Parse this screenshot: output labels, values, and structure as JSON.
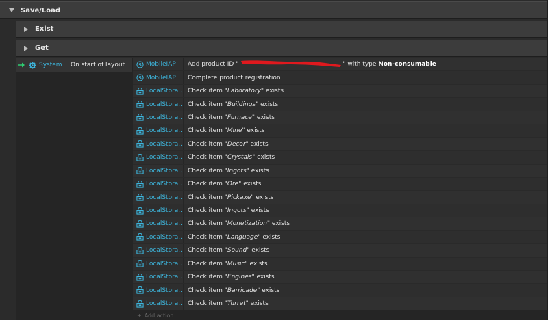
{
  "groups": {
    "main": {
      "title": "Save/Load"
    },
    "exist": {
      "title": "Exist"
    },
    "get": {
      "title": "Get"
    }
  },
  "event": {
    "condition_object": "System",
    "trigger": "On start of layout"
  },
  "actions": [
    {
      "object": "MobileIAP",
      "icon": "mobileiap-icon",
      "prefix": "Add product ID \"",
      "redacted": true,
      "suffix": "\" with type ",
      "bold": "Non-consumable"
    },
    {
      "object": "MobileIAP",
      "icon": "mobileiap-icon",
      "text": "Complete product registration"
    },
    {
      "object": "LocalStora...",
      "icon": "localstorage-icon",
      "item": "Laboratory"
    },
    {
      "object": "LocalStora...",
      "icon": "localstorage-icon",
      "item": "Buildings"
    },
    {
      "object": "LocalStora...",
      "icon": "localstorage-icon",
      "item": "Furnace"
    },
    {
      "object": "LocalStora...",
      "icon": "localstorage-icon",
      "item": "Mine"
    },
    {
      "object": "LocalStora...",
      "icon": "localstorage-icon",
      "item": "Decor"
    },
    {
      "object": "LocalStora...",
      "icon": "localstorage-icon",
      "item": "Crystals"
    },
    {
      "object": "LocalStora...",
      "icon": "localstorage-icon",
      "item": "Ingots"
    },
    {
      "object": "LocalStora...",
      "icon": "localstorage-icon",
      "item": "Ore"
    },
    {
      "object": "LocalStora...",
      "icon": "localstorage-icon",
      "item": "Pickaxe"
    },
    {
      "object": "LocalStora...",
      "icon": "localstorage-icon",
      "item": "Ingots"
    },
    {
      "object": "LocalStora...",
      "icon": "localstorage-icon",
      "item": "Monetization"
    },
    {
      "object": "LocalStora...",
      "icon": "localstorage-icon",
      "item": "Language"
    },
    {
      "object": "LocalStora...",
      "icon": "localstorage-icon",
      "item": "Sound"
    },
    {
      "object": "LocalStora...",
      "icon": "localstorage-icon",
      "item": "Music"
    },
    {
      "object": "LocalStora...",
      "icon": "localstorage-icon",
      "item": "Engines"
    },
    {
      "object": "LocalStora...",
      "icon": "localstorage-icon",
      "item": "Barricade"
    },
    {
      "object": "LocalStora...",
      "icon": "localstorage-icon",
      "item": "Turret"
    }
  ],
  "check_prefix": "Check item ",
  "check_suffix": " exists",
  "add_action_label": "Add action",
  "colors": {
    "accent": "#3db5dc",
    "arrow": "#2ecc71",
    "redaction": "#e0191e"
  }
}
